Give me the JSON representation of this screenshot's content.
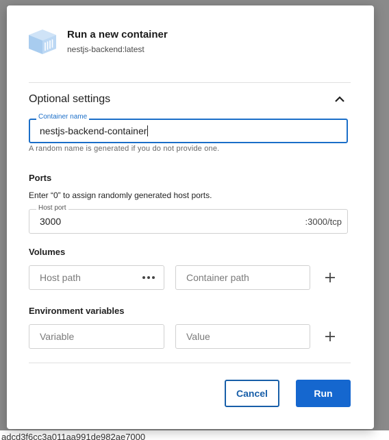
{
  "background": {
    "container_id_text": "adcd3f6cc3a011aa991de982ae7000"
  },
  "dialog": {
    "title": "Run a new container",
    "image_name": "nestjs-backend:latest",
    "icon": "container-cube-icon",
    "optional_settings": {
      "title": "Optional settings",
      "expanded": true,
      "toggle_icon": "chevron-up-icon"
    },
    "container_name": {
      "label": "Container name",
      "value": "nestjs-backend-container",
      "helper": "A random name is generated if you do not provide one."
    },
    "ports": {
      "title": "Ports",
      "description": "Enter “0” to assign randomly generated host ports.",
      "host_port_label": "Host port",
      "host_port_value": "3000",
      "container_port": ":3000/tcp"
    },
    "volumes": {
      "title": "Volumes",
      "host_path_placeholder": "Host path",
      "container_path_placeholder": "Container path",
      "browse_icon": "more-horizontal-icon",
      "add_icon": "plus-icon"
    },
    "env": {
      "title": "Environment variables",
      "variable_placeholder": "Variable",
      "value_placeholder": "Value",
      "add_icon": "plus-icon"
    },
    "actions": {
      "cancel_label": "Cancel",
      "run_label": "Run"
    }
  },
  "colors": {
    "accent": "#1567cf",
    "focus_border": "#1a6ec8",
    "overlay": "#8a8a8a"
  }
}
